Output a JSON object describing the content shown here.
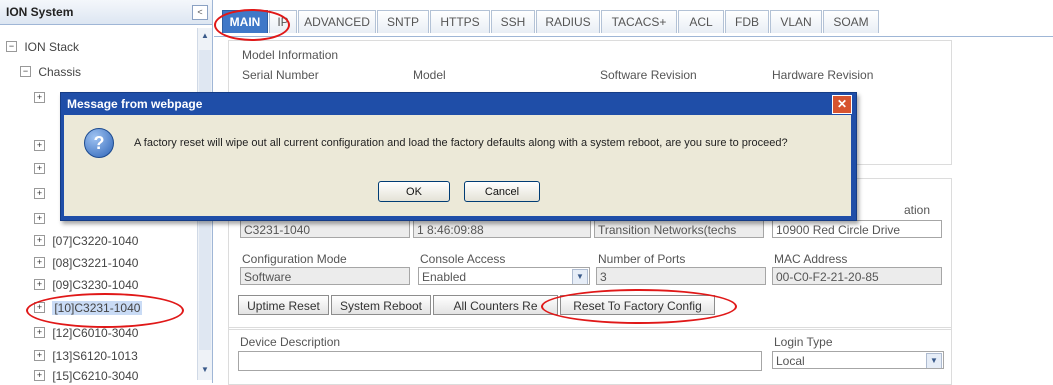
{
  "sidebar": {
    "title": "ION System",
    "collapse_icon": "<",
    "tree": [
      {
        "toggle": "−",
        "label": "ION Stack"
      },
      {
        "toggle": "−",
        "label": "Chassis"
      },
      {
        "toggle": "+",
        "label": "[07]C3220-1040"
      },
      {
        "toggle": "+",
        "label": "[08]C3221-1040"
      },
      {
        "toggle": "+",
        "label": "[09]C3230-1040"
      },
      {
        "toggle": "+",
        "label": "[10]C3231-1040"
      },
      {
        "toggle": "+",
        "label": "[12]C6010-3040"
      },
      {
        "toggle": "+",
        "label": "[13]S6120-1013"
      },
      {
        "toggle": "+",
        "label": "[15]C6210-3040"
      }
    ]
  },
  "tabs": [
    "MAIN",
    "IP",
    "ADVANCED",
    "SNTP",
    "HTTPS",
    "SSH",
    "RADIUS",
    "TACACS+",
    "ACL",
    "FDB",
    "VLAN",
    "SOAM"
  ],
  "main": {
    "model_info_title": "Model Information",
    "serial_number_label": "Serial Number",
    "model_label": "Model",
    "software_revision_label": "Software Revision",
    "hardware_revision_label": "Hardware Revision",
    "row2": {
      "model_value": "C3231-1040",
      "time_value": "1 8:46:09:88",
      "company_value": "Transition Networks(techs",
      "location_label": "ation",
      "location_value": "10900 Red Circle Drive"
    },
    "config_mode_label": "Configuration Mode",
    "config_mode_value": "Software",
    "console_access_label": "Console Access",
    "console_access_value": "Enabled",
    "num_ports_label": "Number of Ports",
    "num_ports_value": "3",
    "mac_label": "MAC Address",
    "mac_value": "00-C0-F2-21-20-85",
    "buttons": {
      "uptime_reset": "Uptime Reset",
      "system_reboot": "System Reboot",
      "all_counters_reset": "All Counters Re",
      "reset_factory": "Reset To Factory Config"
    },
    "device_description_label": "Device Description",
    "device_description_value": "",
    "login_type_label": "Login Type",
    "login_type_value": "Local"
  },
  "dialog": {
    "title": "Message from webpage",
    "icon": "?",
    "message": "A factory reset will wipe out all current configuration and load the factory defaults along with a system reboot, are you sure to proceed?",
    "ok_label": "OK",
    "cancel_label": "Cancel",
    "close_icon": "✕"
  },
  "colors": {
    "annotation_red": "#e01818",
    "active_tab": "#3f78c8",
    "dialog_title_bar": "#1f4ea8",
    "dialog_body": "#ece9d8"
  }
}
